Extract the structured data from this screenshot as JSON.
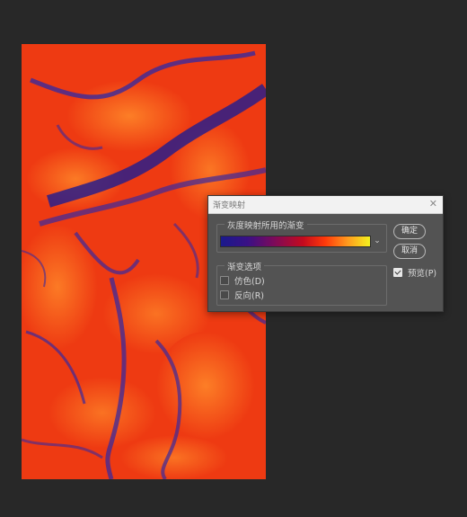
{
  "dialog": {
    "title": "渐变映射",
    "close_glyph": "✕",
    "gradient_group_label": "灰度映射所用的渐变",
    "gradient_dropdown_glyph": "⌄",
    "options_group_label": "渐变选项",
    "options": [
      {
        "label": "仿色(D)",
        "checked": false
      },
      {
        "label": "反向(R)",
        "checked": false
      }
    ],
    "ok_label": "确定",
    "cancel_label": "取消",
    "preview_label": "预览(P)",
    "preview_checked": true,
    "gradient_colors": [
      "#1a1a8c",
      "#7a0a5c",
      "#c40a1e",
      "#ff3a0a",
      "#ff9a1e",
      "#f4f21e"
    ]
  },
  "colors": {
    "workspace_bg": "#282828",
    "dialog_bg": "#535353",
    "titlebar_bg": "#f2f2f2",
    "image_red": "#ee3a12",
    "image_orange": "#ff7a1e",
    "image_blue": "#3a2a9c"
  }
}
